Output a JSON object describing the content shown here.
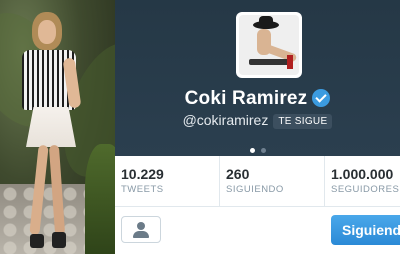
{
  "profile": {
    "name": "Coki Ramirez",
    "handle": "@cokiramirez",
    "follows_you_badge": "TE SIGUE",
    "verified_icon": "verified-check-icon"
  },
  "stats": [
    {
      "value": "10.229",
      "label": "TWEETS"
    },
    {
      "value": "260",
      "label": "SIGUIENDO"
    },
    {
      "value": "1.000.000",
      "label": "SEGUIDORES"
    }
  ],
  "actions": {
    "person_icon": "person-icon",
    "following_label": "Siguiendo"
  },
  "colors": {
    "header_bg": "#2b3f4f",
    "verified": "#3b9be0",
    "button_blue": "#2b8ad6"
  }
}
